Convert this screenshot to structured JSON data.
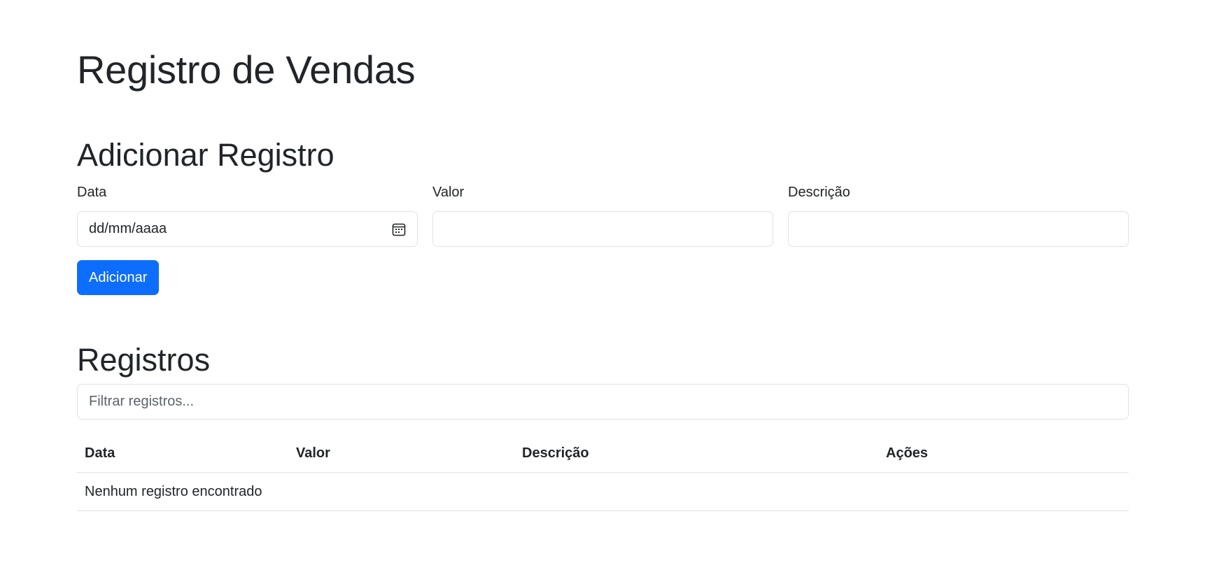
{
  "page": {
    "title": "Registro de Vendas"
  },
  "add_section": {
    "title": "Adicionar Registro",
    "fields": {
      "data": {
        "label": "Data",
        "placeholder": "dd/mm/aaaa",
        "value": ""
      },
      "valor": {
        "label": "Valor",
        "value": ""
      },
      "descricao": {
        "label": "Descrição",
        "value": ""
      }
    },
    "submit_label": "Adicionar"
  },
  "records_section": {
    "title": "Registros",
    "filter_placeholder": "Filtrar registros...",
    "columns": [
      "Data",
      "Valor",
      "Descrição",
      "Ações"
    ],
    "rows": [],
    "empty_message": "Nenhum registro encontrado"
  },
  "icons": {
    "date_picker": "calendar-icon"
  },
  "colors": {
    "primary": "#0d6efd",
    "text": "#212529",
    "border": "#dee2e6"
  }
}
